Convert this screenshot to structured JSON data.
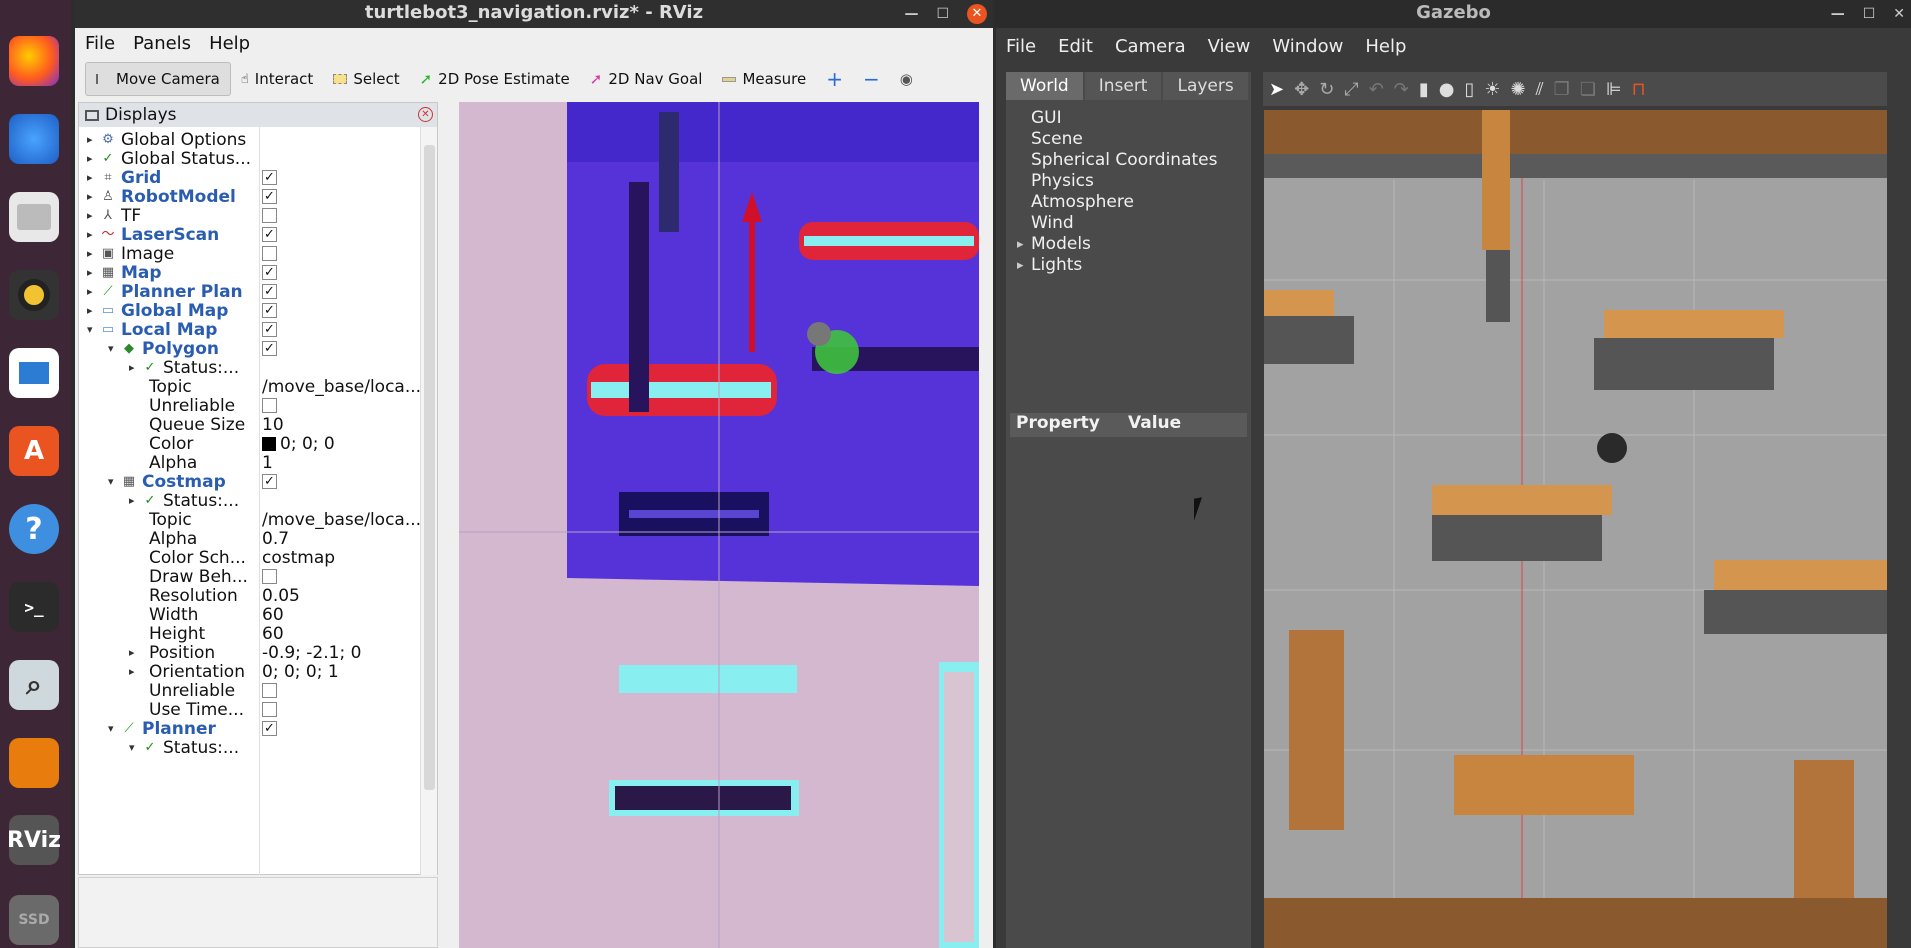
{
  "dock": {
    "apps": [
      "firefox-icon",
      "thunderbird-icon",
      "files-icon",
      "rhythmbox-icon",
      "libreoffice-impress-icon",
      "app-store-icon",
      "help-icon",
      "terminal-icon",
      "search-icon",
      "blender-icon",
      "rviz-icon",
      "ssd-icon"
    ],
    "rviz_label": "RViz",
    "ssd_label": "SSD"
  },
  "rviz": {
    "title": "turtlebot3_navigation.rviz* - RViz",
    "menu": [
      "File",
      "Panels",
      "Help"
    ],
    "toolbar": [
      "Move Camera",
      "Interact",
      "Select",
      "2D Pose Estimate",
      "2D Nav Goal",
      "Measure"
    ],
    "displays_title": "Displays",
    "tree": [
      {
        "name": "Global Options",
        "icon": "gear-icon",
        "bold": false
      },
      {
        "name": "Global Status...",
        "icon": "check-icon",
        "bold": false
      },
      {
        "name": "Grid",
        "icon": "grid-icon",
        "bold": true,
        "checked": true
      },
      {
        "name": "RobotModel",
        "icon": "robot-icon",
        "bold": true,
        "checked": true
      },
      {
        "name": "TF",
        "icon": "tf-icon",
        "bold": false,
        "checked": false
      },
      {
        "name": "LaserScan",
        "icon": "laser-icon",
        "bold": true,
        "checked": true
      },
      {
        "name": "Image",
        "icon": "image-icon",
        "bold": false,
        "checked": false
      },
      {
        "name": "Map",
        "icon": "map-icon",
        "bold": true,
        "checked": true
      },
      {
        "name": "Planner Plan",
        "icon": "path-icon",
        "bold": true,
        "checked": true
      },
      {
        "name": "Global Map",
        "icon": "folder-icon",
        "bold": true,
        "checked": true
      },
      {
        "name": "Local Map",
        "icon": "folder-icon",
        "bold": true,
        "checked": true
      },
      {
        "name": "Polygon",
        "icon": "polygon-icon",
        "bold": true,
        "checked": true
      },
      {
        "name": "Status:...",
        "icon": "check-icon",
        "bold": false
      },
      {
        "name": "Topic",
        "value": "/move_base/loca..."
      },
      {
        "name": "Unreliable",
        "checked": false
      },
      {
        "name": "Queue Size",
        "value": "10"
      },
      {
        "name": "Color",
        "value": "0; 0; 0"
      },
      {
        "name": "Alpha",
        "value": "1"
      },
      {
        "name": "Costmap",
        "icon": "map-icon",
        "bold": true,
        "checked": true
      },
      {
        "name": "Status:...",
        "icon": "check-icon",
        "bold": false
      },
      {
        "name": "Topic",
        "value": "/move_base/loca..."
      },
      {
        "name": "Alpha",
        "value": "0.7"
      },
      {
        "name": "Color Sch...",
        "value": "costmap"
      },
      {
        "name": "Draw Beh...",
        "checked": false
      },
      {
        "name": "Resolution",
        "value": "0.05"
      },
      {
        "name": "Width",
        "value": "60"
      },
      {
        "name": "Height",
        "value": "60"
      },
      {
        "name": "Position",
        "value": "-0.9; -2.1; 0"
      },
      {
        "name": "Orientation",
        "value": "0; 0; 0; 1"
      },
      {
        "name": "Unreliable",
        "checked": false
      },
      {
        "name": "Use Time...",
        "checked": false
      },
      {
        "name": "Planner",
        "icon": "path-icon",
        "bold": true,
        "checked": true
      },
      {
        "name": "Status:...",
        "icon": "check-icon",
        "bold": false
      }
    ]
  },
  "gazebo": {
    "title": "Gazebo",
    "menu": [
      "File",
      "Edit",
      "Camera",
      "View",
      "Window",
      "Help"
    ],
    "tabs": [
      "World",
      "Insert",
      "Layers"
    ],
    "world_tree": [
      "GUI",
      "Scene",
      "Spherical Coordinates",
      "Physics",
      "Atmosphere",
      "Wind",
      "Models",
      "Lights"
    ],
    "prop_header": [
      "Property",
      "Value"
    ]
  }
}
